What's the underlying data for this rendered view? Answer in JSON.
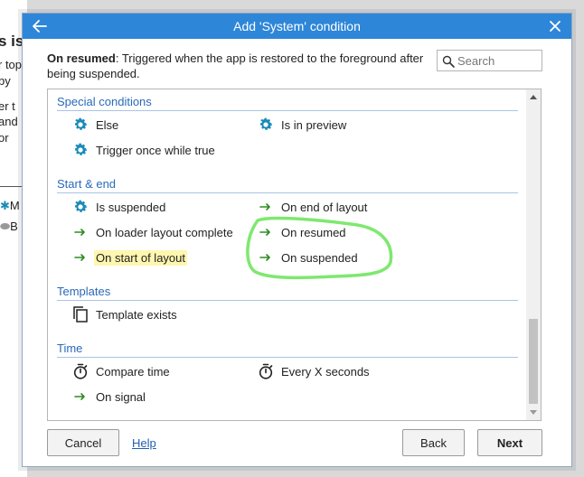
{
  "dialog": {
    "title": "Add 'System' condition",
    "description_bold": "On resumed",
    "description_text": ": Triggered when the app is restored to the foreground after being suspended.",
    "search_placeholder": "Search"
  },
  "sections": [
    {
      "title": "Special conditions",
      "items": [
        {
          "label": "Else",
          "icon": "gear-icon"
        },
        {
          "label": "Is in preview",
          "icon": "gear-icon"
        },
        {
          "label": "Trigger once while true",
          "icon": "gear-icon"
        }
      ]
    },
    {
      "title": "Start & end",
      "items": [
        {
          "label": "Is suspended",
          "icon": "gear-icon"
        },
        {
          "label": "On end of layout",
          "icon": "trigger-arrow-icon"
        },
        {
          "label": "On loader layout complete",
          "icon": "trigger-arrow-icon"
        },
        {
          "label": "On resumed",
          "icon": "trigger-arrow-icon"
        },
        {
          "label": "On start of layout",
          "icon": "trigger-arrow-icon"
        },
        {
          "label": "On suspended",
          "icon": "trigger-arrow-icon"
        }
      ]
    },
    {
      "title": "Templates",
      "items": [
        {
          "label": "Template exists",
          "icon": "copy-icon"
        }
      ]
    },
    {
      "title": "Time",
      "items": [
        {
          "label": "Compare time",
          "icon": "stopwatch-icon"
        },
        {
          "label": "Every X seconds",
          "icon": "stopwatch-icon"
        },
        {
          "label": "On signal",
          "icon": "trigger-arrow-icon"
        }
      ]
    }
  ],
  "buttons": {
    "cancel": "Cancel",
    "help": "Help",
    "back": "Back",
    "next": "Next"
  },
  "background": {
    "title_fragment": "s is",
    "lines": [
      "r top",
      "by",
      "er t",
      "and",
      "or"
    ],
    "list_fragments": [
      "M",
      "B"
    ]
  },
  "colors": {
    "titlebar": "#2e86d8",
    "section_header": "#2a6ab8",
    "gear": "#1a8bb8",
    "trigger_arrow": "#2e8b22",
    "highlight": "#fff6b0",
    "annotation": "#7ee86f"
  }
}
